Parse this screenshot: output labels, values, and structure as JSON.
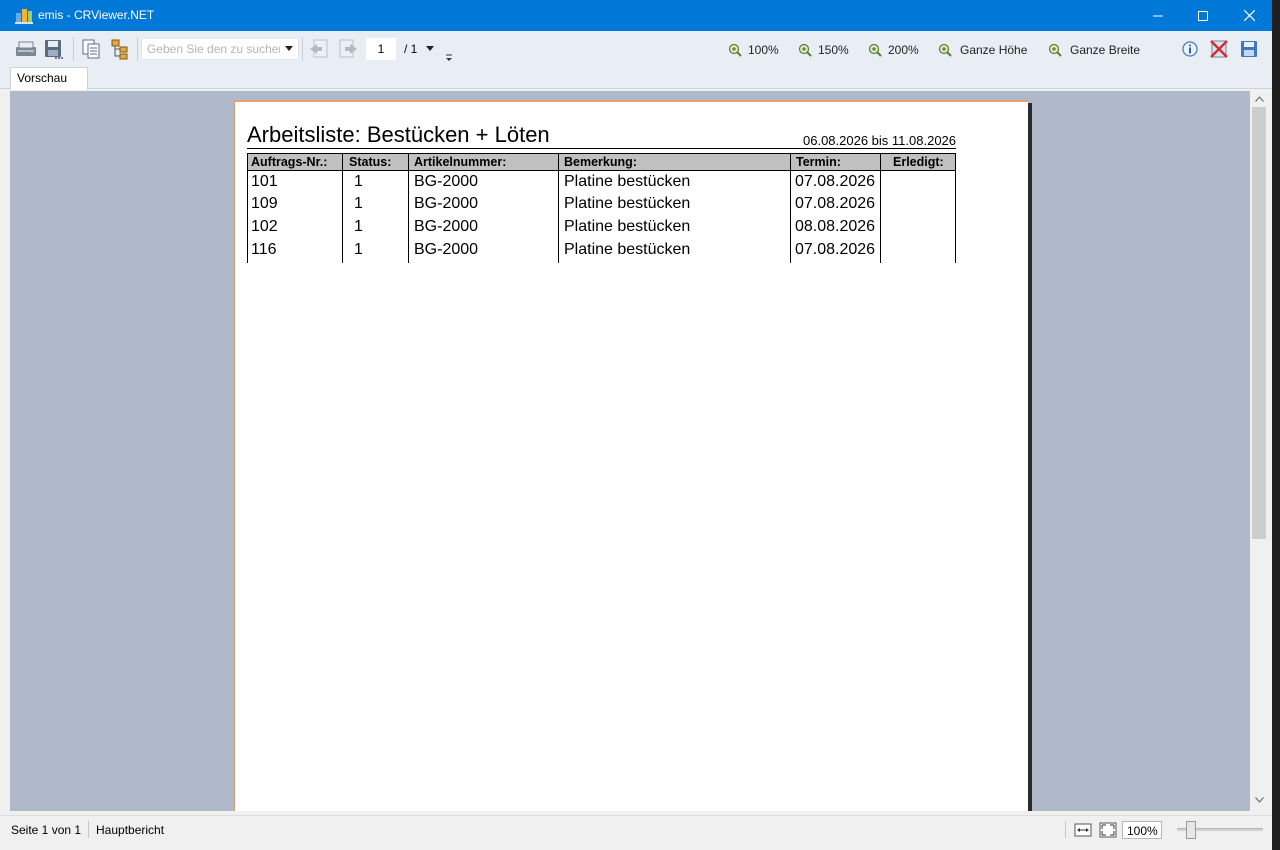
{
  "window": {
    "title": "emis - CRViewer.NET",
    "accent": "#0078d7"
  },
  "toolbar": {
    "icons": [
      "printer-icon",
      "export-icon",
      "copy-icon",
      "group-tree-icon",
      "first-page-icon",
      "previous-page-icon",
      "next-page-icon",
      "last-page-icon"
    ],
    "search_placeholder": "Geben Sie den zu suchenden Text ein",
    "page_current": "1",
    "page_total": "/ 1",
    "zoom_100": "100%",
    "zoom_150": "150%",
    "zoom_200": "200%",
    "zoom_full_height": "Ganze Höhe",
    "zoom_full_width": "Ganze Breite",
    "right_icons": [
      "info-icon",
      "close-report-icon",
      "save-icon"
    ]
  },
  "tabs": [
    {
      "label": "Vorschau",
      "active": true
    }
  ],
  "report": {
    "title": "Arbeitsliste: Bestücken + Löten",
    "date_range": "06.08.2026 bis 11.08.2026",
    "columns": [
      "Auftrags-Nr.:",
      "Status:",
      "Artikelnummer:",
      "Bemerkung:",
      "Termin:",
      "Erledigt:"
    ],
    "rows": [
      {
        "order": "101",
        "status": "1",
        "article": "BG-2000",
        "remark": "Platine bestücken",
        "date": "07.08.2026",
        "done": ""
      },
      {
        "order": "109",
        "status": "1",
        "article": "BG-2000",
        "remark": "Platine bestücken",
        "date": "07.08.2026",
        "done": ""
      },
      {
        "order": "102",
        "status": "1",
        "article": "BG-2000",
        "remark": "Platine bestücken",
        "date": "08.08.2026",
        "done": ""
      },
      {
        "order": "116",
        "status": "1",
        "article": "BG-2000",
        "remark": "Platine bestücken",
        "date": "07.08.2026",
        "done": ""
      }
    ]
  },
  "statusbar": {
    "page_info": "Seite 1 von 1",
    "report_name": "Hauptbericht",
    "zoom_value": "100%",
    "zoom_fraction": 0.12
  }
}
